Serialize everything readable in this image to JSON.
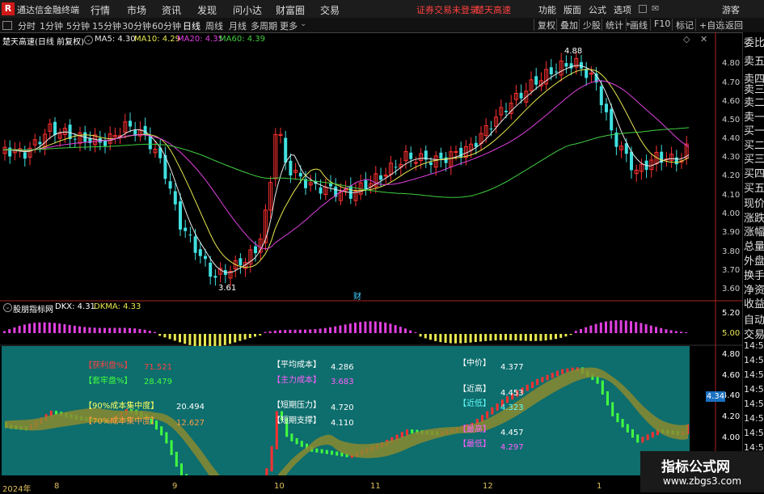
{
  "menubar": {
    "app_name": "通达信金融终端",
    "items": [
      "行情",
      "市场",
      "资讯",
      "发现",
      "问小达",
      "财富圈",
      "交易"
    ],
    "status": "证券交易未登录",
    "stock": "楚天高速",
    "right_items": [
      "功能",
      "版面",
      "公式",
      "选项"
    ],
    "user": "游客"
  },
  "toolbar": {
    "periods": [
      "分时",
      "1分钟",
      "5分钟",
      "15分钟",
      "30分钟",
      "60分钟",
      "日线",
      "周线",
      "月线",
      "多周期",
      "更多"
    ],
    "active": "日线",
    "right": [
      "复权",
      "叠加",
      "少股",
      "统计",
      "画线",
      "F10",
      "标记",
      "+自选",
      "返回"
    ]
  },
  "main_chart": {
    "title": "楚天高速(日线 前复权)",
    "ma": [
      {
        "label": "MA5: 4.30",
        "color": "#e8e8e8"
      },
      {
        "label": "MA10: 4.29",
        "color": "#e8e850"
      },
      {
        "label": "MA20: 4.35",
        "color": "#e040e0"
      },
      {
        "label": "MA60: 4.39",
        "color": "#40d040"
      }
    ],
    "y_ticks": [
      "4.80",
      "4.70",
      "4.60",
      "4.50",
      "4.40",
      "4.30",
      "4.20",
      "4.10",
      "4.00",
      "3.90",
      "3.80",
      "3.70",
      "3.60"
    ],
    "high_label": "4.88",
    "low_label": "3.61",
    "marker": "财"
  },
  "indicator": {
    "title": "股朋指标网",
    "dkx": "DKX: 4.31",
    "dkma": "DKMA: 4.33",
    "y_ticks": [
      "5.20",
      "5.00",
      "4.80",
      "4.60",
      "4.40",
      "4.20",
      "4.00"
    ],
    "current_price": "4.34"
  },
  "chips": {
    "profit_label": "【获利盘%】",
    "profit_value": "71.521",
    "trapped_label": "【套牢盘%】",
    "trapped_value": "28.479",
    "c90_label": "【90%成本集中度】",
    "c90_value": "20.494",
    "c70_label": "【70%成本集中度】",
    "c70_value": "12.627",
    "avg_cost_label": "【平均成本】",
    "avg_cost_value": "4.286",
    "main_cost_label": "【主力成本】",
    "main_cost_value": "3.683",
    "short_press_label": "【短期压力】",
    "short_press_value": "4.720",
    "short_support_label": "【短期支撑】",
    "short_support_value": "4.110",
    "mid_label": "【中价】",
    "mid_value": "4.377",
    "near_high_label": "【近高】",
    "near_high_value": "4.453",
    "near_low_label": "【近低】",
    "near_low_value": "4.323",
    "highest_label": "【最高】",
    "highest_value": "4.457",
    "lowest_label": "【最低】",
    "lowest_value": "4.297"
  },
  "x_axis": [
    "2024年",
    "8",
    "9",
    "10",
    "11",
    "12",
    "1"
  ],
  "right_panel": [
    "委比",
    "卖五",
    "卖四",
    "卖三",
    "卖二",
    "卖一",
    "买一",
    "买二",
    "买三",
    "买四",
    "买五",
    "现价",
    "涨跌",
    "涨幅",
    "总量",
    "外盘",
    "换手",
    "净资",
    "收益",
    "自动",
    "交易",
    "14:56",
    "14:56",
    "14:56",
    "14:56",
    "14:56",
    "14:56",
    "14:56",
    "14:56"
  ],
  "watermark": {
    "title": "指标公式网",
    "url": "www.zbgs3.com"
  },
  "colors": {
    "up": "#ff3030",
    "down": "#40e0e0",
    "bg": "#000000",
    "teal": "#0e6d6d",
    "ma5": "#e8e8e8",
    "ma10": "#e8e850",
    "ma20": "#e040e0",
    "ma60": "#40d040"
  }
}
